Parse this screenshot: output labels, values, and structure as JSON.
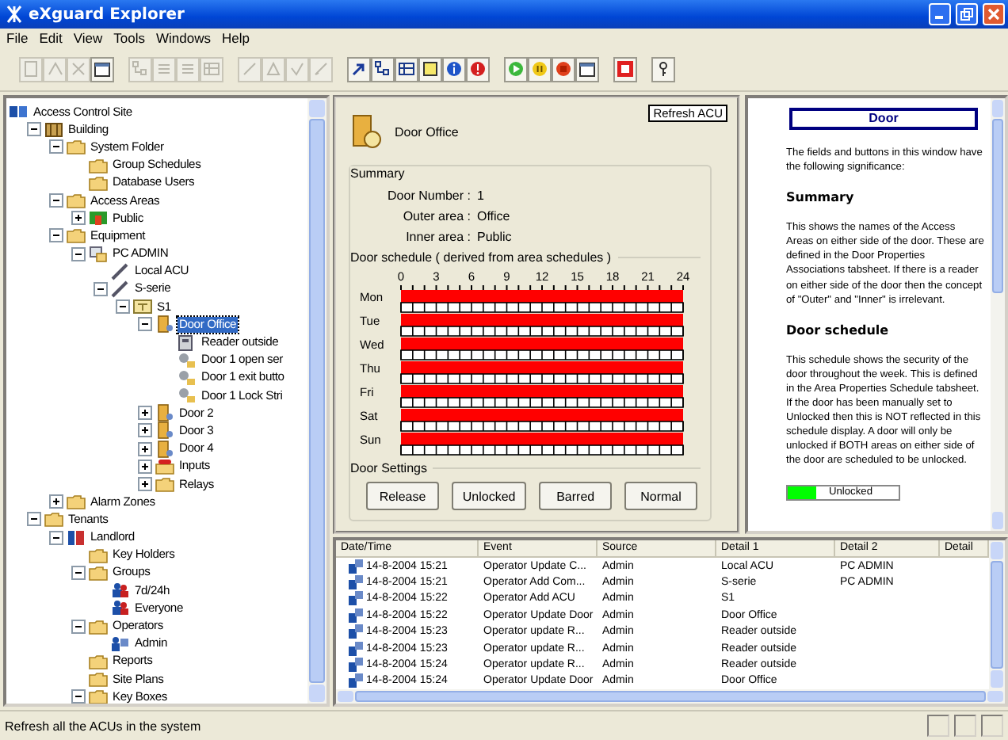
{
  "window": {
    "title": "eXguard Explorer"
  },
  "menu": [
    "File",
    "Edit",
    "View",
    "Tools",
    "Windows",
    "Help"
  ],
  "toolbar": [
    {
      "buttons": [
        {
          "kind": "page",
          "disabled": true
        },
        {
          "kind": "up",
          "disabled": true
        },
        {
          "kind": "cross",
          "disabled": true
        },
        {
          "kind": "window",
          "disabled": false
        }
      ]
    },
    {
      "buttons": [
        {
          "kind": "tree",
          "disabled": true
        },
        {
          "kind": "list",
          "disabled": true
        },
        {
          "kind": "list",
          "disabled": true
        },
        {
          "kind": "grid",
          "disabled": true
        }
      ]
    },
    {
      "buttons": [
        {
          "kind": "line",
          "disabled": true
        },
        {
          "kind": "triangle",
          "disabled": true
        },
        {
          "kind": "check",
          "disabled": true
        },
        {
          "kind": "pen",
          "disabled": true
        }
      ]
    },
    {
      "buttons": [
        {
          "kind": "arrow",
          "disabled": false
        },
        {
          "kind": "tree",
          "disabled": false
        },
        {
          "kind": "grid",
          "disabled": false
        },
        {
          "kind": "help",
          "disabled": false
        },
        {
          "kind": "info",
          "disabled": false
        },
        {
          "kind": "alert",
          "disabled": false
        }
      ]
    },
    {
      "buttons": [
        {
          "kind": "play",
          "disabled": false
        },
        {
          "kind": "pause",
          "disabled": false
        },
        {
          "kind": "stop",
          "disabled": false
        },
        {
          "kind": "window",
          "disabled": false
        }
      ]
    },
    {
      "buttons": [
        {
          "kind": "panel",
          "disabled": false
        }
      ]
    },
    {
      "buttons": [
        {
          "kind": "key",
          "disabled": false
        }
      ]
    }
  ],
  "tree": {
    "label": "Access Control Site",
    "kind": "site",
    "selected": false,
    "children": [
      {
        "label": "Building",
        "kind": "building",
        "expanded": true,
        "selected": false,
        "children": [
          {
            "label": "System Folder",
            "kind": "folder",
            "expanded": true,
            "selected": false,
            "children": [
              {
                "label": "Group Schedules",
                "kind": "folder",
                "selected": false
              },
              {
                "label": "Database Users",
                "kind": "folder",
                "selected": false
              }
            ]
          },
          {
            "label": "Access Areas",
            "kind": "folder",
            "expanded": true,
            "selected": false,
            "children": [
              {
                "label": "Public",
                "kind": "area",
                "expanded": false,
                "selected": false
              }
            ]
          },
          {
            "label": "Equipment",
            "kind": "folder",
            "expanded": true,
            "selected": false,
            "children": [
              {
                "label": "PC ADMIN",
                "kind": "pc",
                "expanded": true,
                "selected": false,
                "children": [
                  {
                    "label": "Local ACU",
                    "kind": "acu",
                    "selected": false
                  },
                  {
                    "label": "S-serie",
                    "kind": "acu",
                    "expanded": true,
                    "selected": false,
                    "children": [
                      {
                        "label": "S1",
                        "kind": "controller",
                        "expanded": true,
                        "selected": false,
                        "children": [
                          {
                            "label": "Door Office",
                            "kind": "door",
                            "expanded": true,
                            "selected": true,
                            "children": [
                              {
                                "label": "Reader outside",
                                "kind": "reader",
                                "selected": false
                              },
                              {
                                "label": "Door 1 open ser",
                                "kind": "io",
                                "selected": false
                              },
                              {
                                "label": "Door 1 exit butto",
                                "kind": "io",
                                "selected": false
                              },
                              {
                                "label": "Door 1 Lock Stri",
                                "kind": "io",
                                "selected": false
                              }
                            ]
                          },
                          {
                            "label": "Door 2",
                            "kind": "door",
                            "expanded": false,
                            "selected": false
                          },
                          {
                            "label": "Door 3",
                            "kind": "door",
                            "expanded": false,
                            "selected": false
                          },
                          {
                            "label": "Door 4",
                            "kind": "door",
                            "expanded": false,
                            "selected": false
                          },
                          {
                            "label": "Inputs",
                            "kind": "alarm-folder",
                            "expanded": false,
                            "selected": false
                          },
                          {
                            "label": "Relays",
                            "kind": "folder",
                            "expanded": false,
                            "selected": false
                          }
                        ]
                      }
                    ]
                  }
                ]
              }
            ]
          },
          {
            "label": "Alarm Zones",
            "kind": "folder",
            "expanded": false,
            "selected": false
          }
        ]
      },
      {
        "label": "Tenants",
        "kind": "folder",
        "expanded": true,
        "selected": false,
        "children": [
          {
            "label": "Landlord",
            "kind": "tenant",
            "expanded": true,
            "selected": false,
            "children": [
              {
                "label": "Key Holders",
                "kind": "folder",
                "selected": false
              },
              {
                "label": "Groups",
                "kind": "folder",
                "expanded": true,
                "selected": false,
                "children": [
                  {
                    "label": "7d/24h",
                    "kind": "group",
                    "selected": false
                  },
                  {
                    "label": "Everyone",
                    "kind": "group",
                    "selected": false
                  }
                ]
              },
              {
                "label": "Operators",
                "kind": "folder",
                "expanded": true,
                "selected": false,
                "children": [
                  {
                    "label": "Admin",
                    "kind": "operator",
                    "selected": false
                  }
                ]
              },
              {
                "label": "Reports",
                "kind": "folder",
                "selected": false
              },
              {
                "label": "Site Plans",
                "kind": "folder",
                "selected": false
              },
              {
                "label": "Key Boxes",
                "kind": "folder",
                "expanded": true,
                "selected": false
              }
            ]
          }
        ]
      }
    ]
  },
  "door_panel": {
    "title": "Door Office",
    "tooltip": "Refresh ACU",
    "summary": {
      "heading": "Summary",
      "fields": [
        {
          "label": "Door Number :",
          "value": "1"
        },
        {
          "label": "Outer area :",
          "value": "Office"
        },
        {
          "label": "Inner area :",
          "value": "Public"
        }
      ]
    },
    "schedule": {
      "heading": "Door schedule ( derived from area schedules )",
      "chart_data": {
        "type": "bar",
        "orientation": "horizontal",
        "categories": [
          "Mon",
          "Tue",
          "Wed",
          "Thu",
          "Fri",
          "Sat",
          "Sun"
        ],
        "series": [
          {
            "color": "#ff0000",
            "values": [
              24,
              24,
              24,
              24,
              24,
              24,
              24
            ]
          }
        ],
        "xlim": [
          0,
          24
        ],
        "xticks": [
          0,
          3,
          6,
          9,
          12,
          15,
          18,
          21,
          24
        ]
      }
    },
    "settings": {
      "heading": "Door Settings",
      "buttons": [
        "Release",
        "Unlocked",
        "Barred",
        "Normal"
      ]
    }
  },
  "help": {
    "title": "Door",
    "sections": [
      {
        "kind": "paragraph",
        "text": "The fields and buttons in this window have the following significance:"
      },
      {
        "kind": "heading",
        "text": "Summary"
      },
      {
        "kind": "paragraph",
        "text": "This shows the names of the Access Areas on either side of the door. These are defined in the Door Properties Associations tabsheet. If there is a reader on either side of the door then the concept of \"Outer\" and \"Inner\" is irrelevant."
      },
      {
        "kind": "heading",
        "text": "Door schedule"
      },
      {
        "kind": "paragraph",
        "text": "This schedule shows the security of the door throughout the week. This is defined in the Area Properties Schedule tabsheet. If the door has been manually set to Unlocked then this is NOT reflected in this schedule display. A door will only be unlocked if BOTH areas on either side of the door are scheduled to be unlocked."
      }
    ],
    "legend": [
      {
        "label": "Unlocked",
        "color": "#00ff00"
      }
    ]
  },
  "log": {
    "columns": [
      "Date/Time",
      "Event",
      "Source",
      "Detail 1",
      "Detail 2",
      "Detail"
    ],
    "rows": [
      {
        "date_time": "14-8-2004 15:21",
        "event": "Operator Update C...",
        "source": "Admin",
        "detail_1": "Local ACU",
        "detail_2": "PC ADMIN"
      },
      {
        "date_time": "14-8-2004 15:21",
        "event": "Operator Add Com...",
        "source": "Admin",
        "detail_1": "S-serie",
        "detail_2": "PC ADMIN"
      },
      {
        "date_time": "14-8-2004 15:22",
        "event": "Operator Add ACU",
        "source": "Admin",
        "detail_1": "S1"
      },
      {
        "date_time": "14-8-2004 15:22",
        "event": "Operator Update Door",
        "source": "Admin",
        "detail_1": "Door Office"
      },
      {
        "date_time": "14-8-2004 15:23",
        "event": "Operator update R...",
        "source": "Admin",
        "detail_1": "Reader outside"
      },
      {
        "date_time": "14-8-2004 15:23",
        "event": "Operator update R...",
        "source": "Admin",
        "detail_1": "Reader outside"
      },
      {
        "date_time": "14-8-2004 15:24",
        "event": "Operator update R...",
        "source": "Admin",
        "detail_1": "Reader outside"
      },
      {
        "date_time": "14-8-2004 15:24",
        "event": "Operator Update Door",
        "source": "Admin",
        "detail_1": "Door Office"
      }
    ]
  },
  "status_bar": {
    "text": "Refresh all the ACUs in the system"
  }
}
